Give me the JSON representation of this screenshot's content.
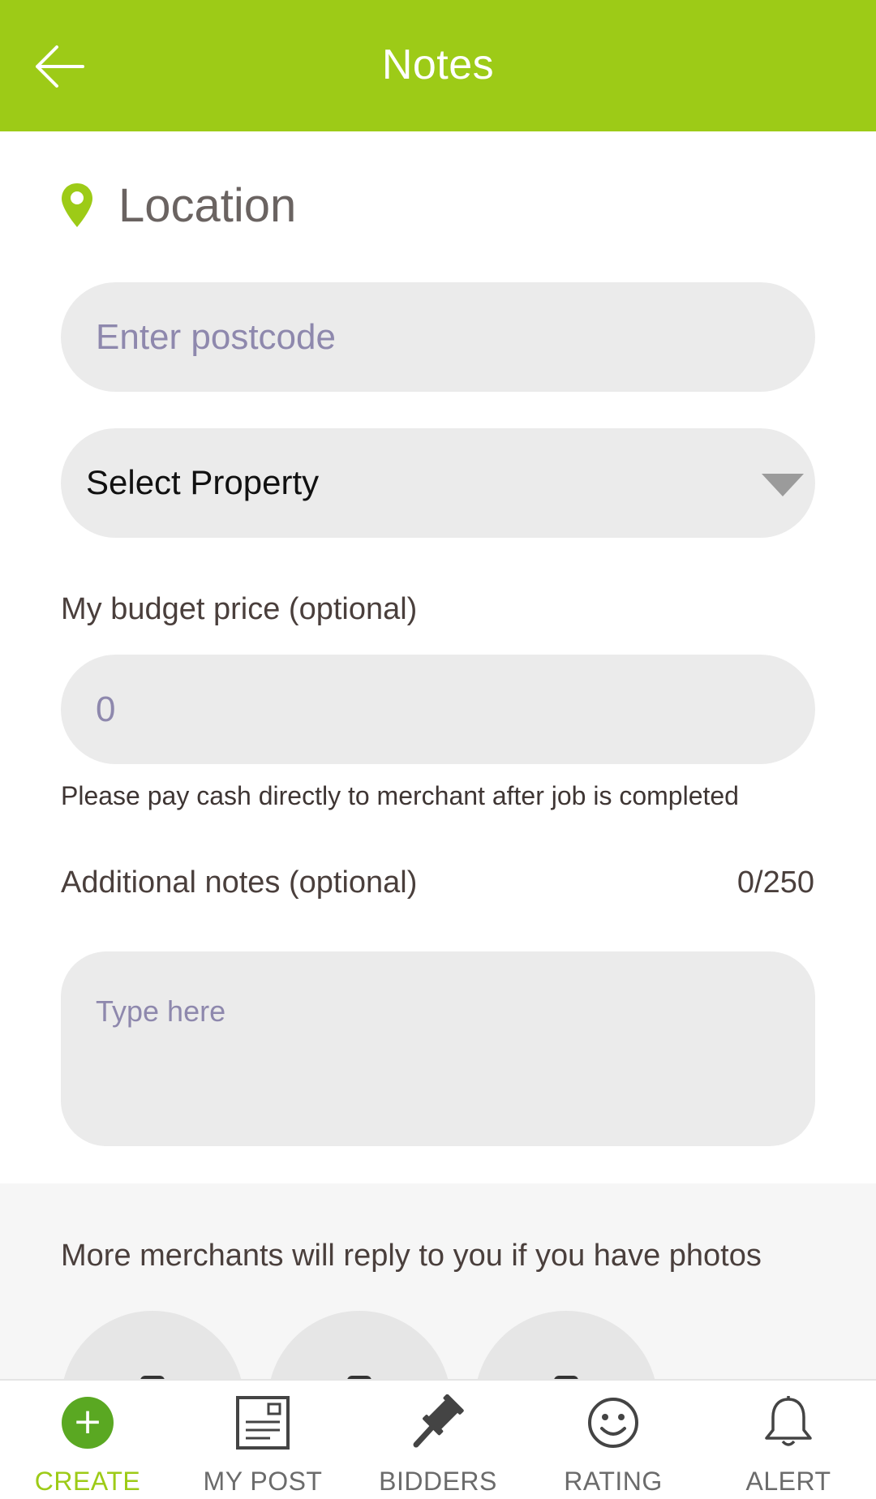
{
  "header": {
    "title": "Notes"
  },
  "location": {
    "title": "Location",
    "postcode_placeholder": "Enter postcode",
    "property_select": "Select Property"
  },
  "budget": {
    "label": "My budget price (optional)",
    "placeholder": "0",
    "note": "Please pay cash directly to merchant after job is completed"
  },
  "notes": {
    "label": "Additional notes (optional)",
    "counter": "0/250",
    "placeholder": "Type here"
  },
  "photos": {
    "hint": "More merchants will reply to you if you have photos"
  },
  "nav": {
    "create": "CREATE",
    "my_post": "MY POST",
    "bidders": "BIDDERS",
    "rating": "RATING",
    "alert": "ALERT"
  },
  "colors": {
    "accent": "#9dcb17",
    "create_button": "#5aa822",
    "field": "#ebebeb"
  }
}
